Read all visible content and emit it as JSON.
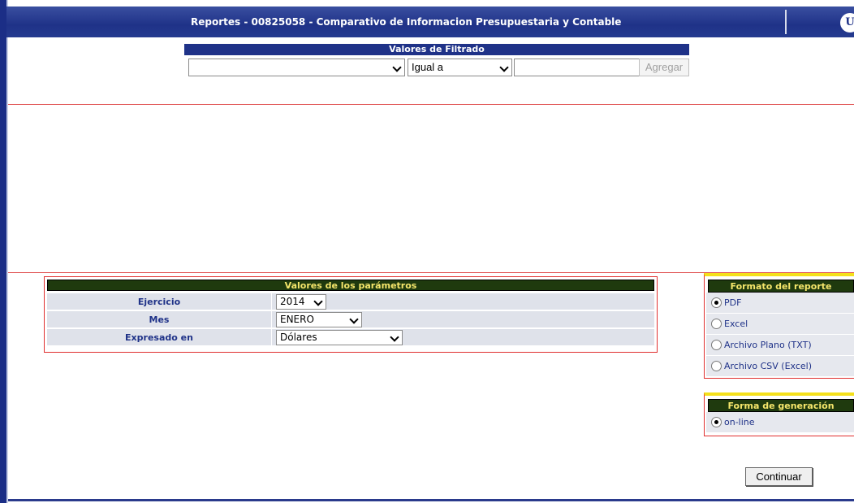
{
  "header": {
    "title": "Reportes - 00825058 - Comparativo de Informacion Presupuestaria y Contable",
    "logo_glyph": "U"
  },
  "filter": {
    "title": "Valores de Filtrado",
    "field_value": "",
    "operator_value": "Igual a",
    "value_input": "",
    "add_label": "Agregar"
  },
  "params": {
    "title": "Valores de los parámetros",
    "rows": [
      {
        "label": "Ejercicio",
        "value": "2014"
      },
      {
        "label": "Mes",
        "value": "ENERO"
      },
      {
        "label": "Expresado en",
        "value": "Dólares"
      }
    ]
  },
  "format": {
    "title": "Formato del reporte",
    "options": [
      {
        "label": "PDF",
        "selected": true
      },
      {
        "label": "Excel",
        "selected": false
      },
      {
        "label": "Archivo Plano (TXT)",
        "selected": false
      },
      {
        "label": "Archivo CSV (Excel)",
        "selected": false
      }
    ]
  },
  "generation": {
    "title": "Forma de generación",
    "options": [
      {
        "label": "on-line",
        "selected": true
      }
    ]
  },
  "actions": {
    "continue_label": "Continuar"
  },
  "colors": {
    "header_blue": "#1f3288",
    "panel_green": "#1f3a0e",
    "panel_title_yellow": "#f5e66b",
    "border_red": "#e03030"
  }
}
